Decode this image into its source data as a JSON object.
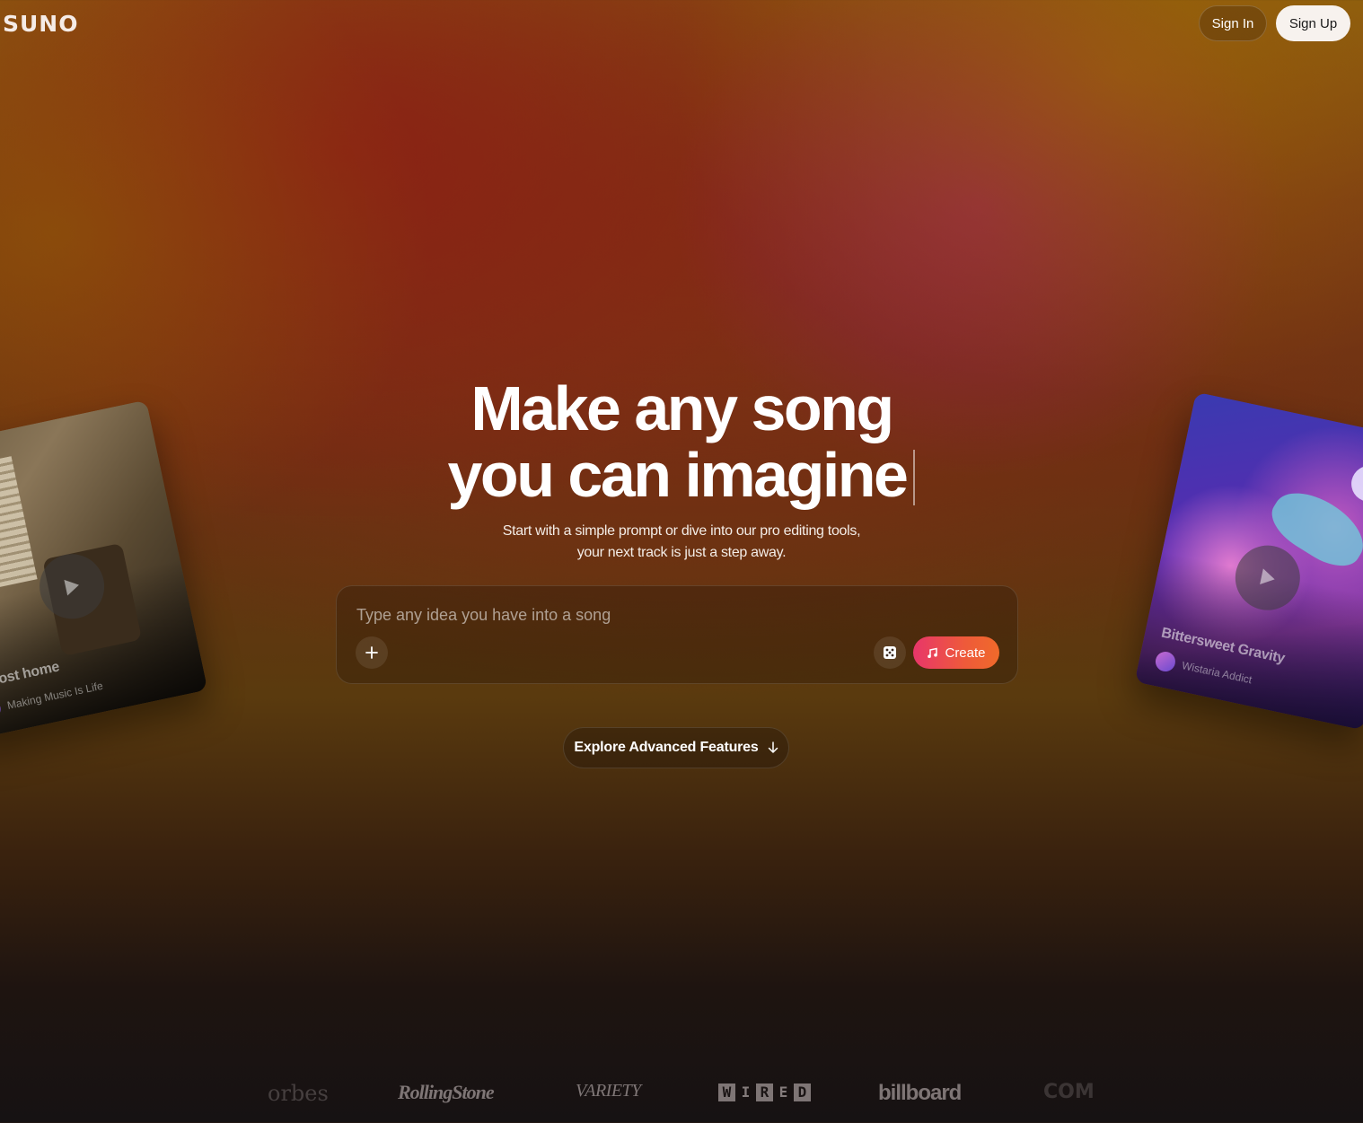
{
  "header": {
    "logo": "SUNO",
    "sign_in": "Sign In",
    "sign_up": "Sign Up"
  },
  "hero": {
    "title_line1": "Make any song",
    "title_line2": "you can imagine",
    "subtitle": "Start with a simple prompt or dive into our pro editing tools, your next track is just a step away."
  },
  "prompt": {
    "placeholder": "Type any idea you have into a song",
    "value": "",
    "add_icon": "plus-icon",
    "random_icon": "dice-icon",
    "create_label": "Create",
    "create_icon": "music-note-icon"
  },
  "explore": {
    "label": "Explore Advanced Features",
    "icon": "arrow-down-icon"
  },
  "cards": {
    "left": {
      "title": "almost home",
      "artist": "Making Music Is Life"
    },
    "right": {
      "title": "Bittersweet Gravity",
      "artist": "Wistaria Addict"
    }
  },
  "press": {
    "forbes": "orbes",
    "rolling_stone": "RollingStone",
    "variety": "VARIETY",
    "wired": [
      "W",
      "I",
      "R",
      "E",
      "D"
    ],
    "billboard": "billboard",
    "complex": "COM"
  },
  "colors": {
    "create_gradient_start": "#e8366a",
    "create_gradient_end": "#f06a2a",
    "sign_up_bg": "#f7f2ee"
  }
}
